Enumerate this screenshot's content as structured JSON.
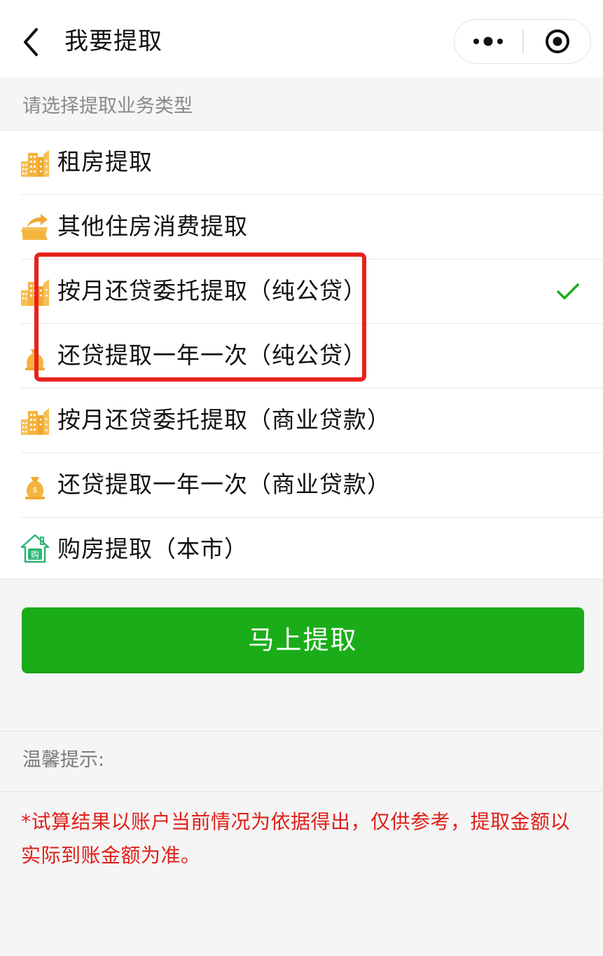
{
  "navbar": {
    "title": "我要提取",
    "back_icon": "chevron-left-icon",
    "more_icon": "more-dots-icon",
    "close_icon": "target-circle-icon"
  },
  "section_header": "请选择提取业务类型",
  "options": [
    {
      "label": "租房提取",
      "icon": "buildings-icon",
      "selected": false
    },
    {
      "label": "其他住房消费提取",
      "icon": "folder-arrow-icon",
      "selected": false
    },
    {
      "label": "按月还贷委托提取（纯公贷）",
      "icon": "buildings-icon",
      "selected": true
    },
    {
      "label": "还贷提取一年一次（纯公贷）",
      "icon": "money-bag-icon",
      "selected": false
    },
    {
      "label": "按月还贷委托提取（商业贷款）",
      "icon": "buildings-icon",
      "selected": false
    },
    {
      "label": "还贷提取一年一次（商业贷款）",
      "icon": "money-bag-icon",
      "selected": false
    },
    {
      "label": "购房提取（本市）",
      "icon": "house-purchase-icon",
      "selected": false
    }
  ],
  "icon_glyph_text": "购",
  "primary_button": "马上提取",
  "tips": {
    "title": "温馨提示:",
    "body": "*试算结果以账户当前情况为依据得出，仅供参考，提取金额以实际到账金额为准。"
  },
  "colors": {
    "accent_green": "#1aad19",
    "check_green": "#1aad19",
    "highlight_red": "#e8231c",
    "warning_red": "#e0201a",
    "icon_orange": "#f5b43c",
    "icon_teal": "#2bb673"
  }
}
